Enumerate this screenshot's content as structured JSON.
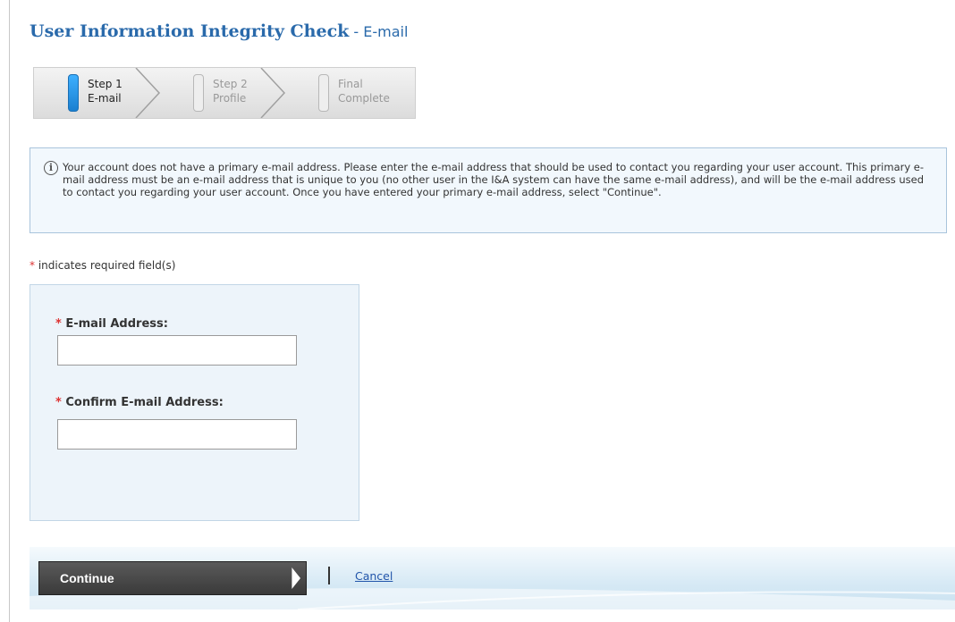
{
  "header": {
    "title": "User Information Integrity Check",
    "separator": " - ",
    "subtitle": "E-mail"
  },
  "steps": [
    {
      "line1": "Step 1",
      "line2": "E-mail",
      "active": true
    },
    {
      "line1": "Step 2",
      "line2": "Profile",
      "active": false
    },
    {
      "line1": "Final",
      "line2": "Complete",
      "active": false
    }
  ],
  "info": {
    "icon": "info-icon",
    "text": "Your account does not have a primary e-mail address. Please enter the e-mail address that should be used to contact you regarding your user account. This primary e-mail address must be an e-mail address that is unique to you (no other user in the I&A system can have the same e-mail address), and will be the e-mail address used to contact you regarding your user account. Once you have entered your primary e-mail address, select \"Continue\"."
  },
  "form": {
    "required_star": "*",
    "required_note": "indicates required field(s)",
    "email_label": "E-mail Address:",
    "email_value": "",
    "confirm_label": "Confirm E-mail Address:",
    "confirm_value": ""
  },
  "actions": {
    "continue_label": "Continue",
    "cancel_label": "Cancel"
  },
  "colors": {
    "title": "#2a6aab",
    "required": "#dd3333",
    "active_step": "#1a7fd0",
    "link": "#2255aa"
  }
}
